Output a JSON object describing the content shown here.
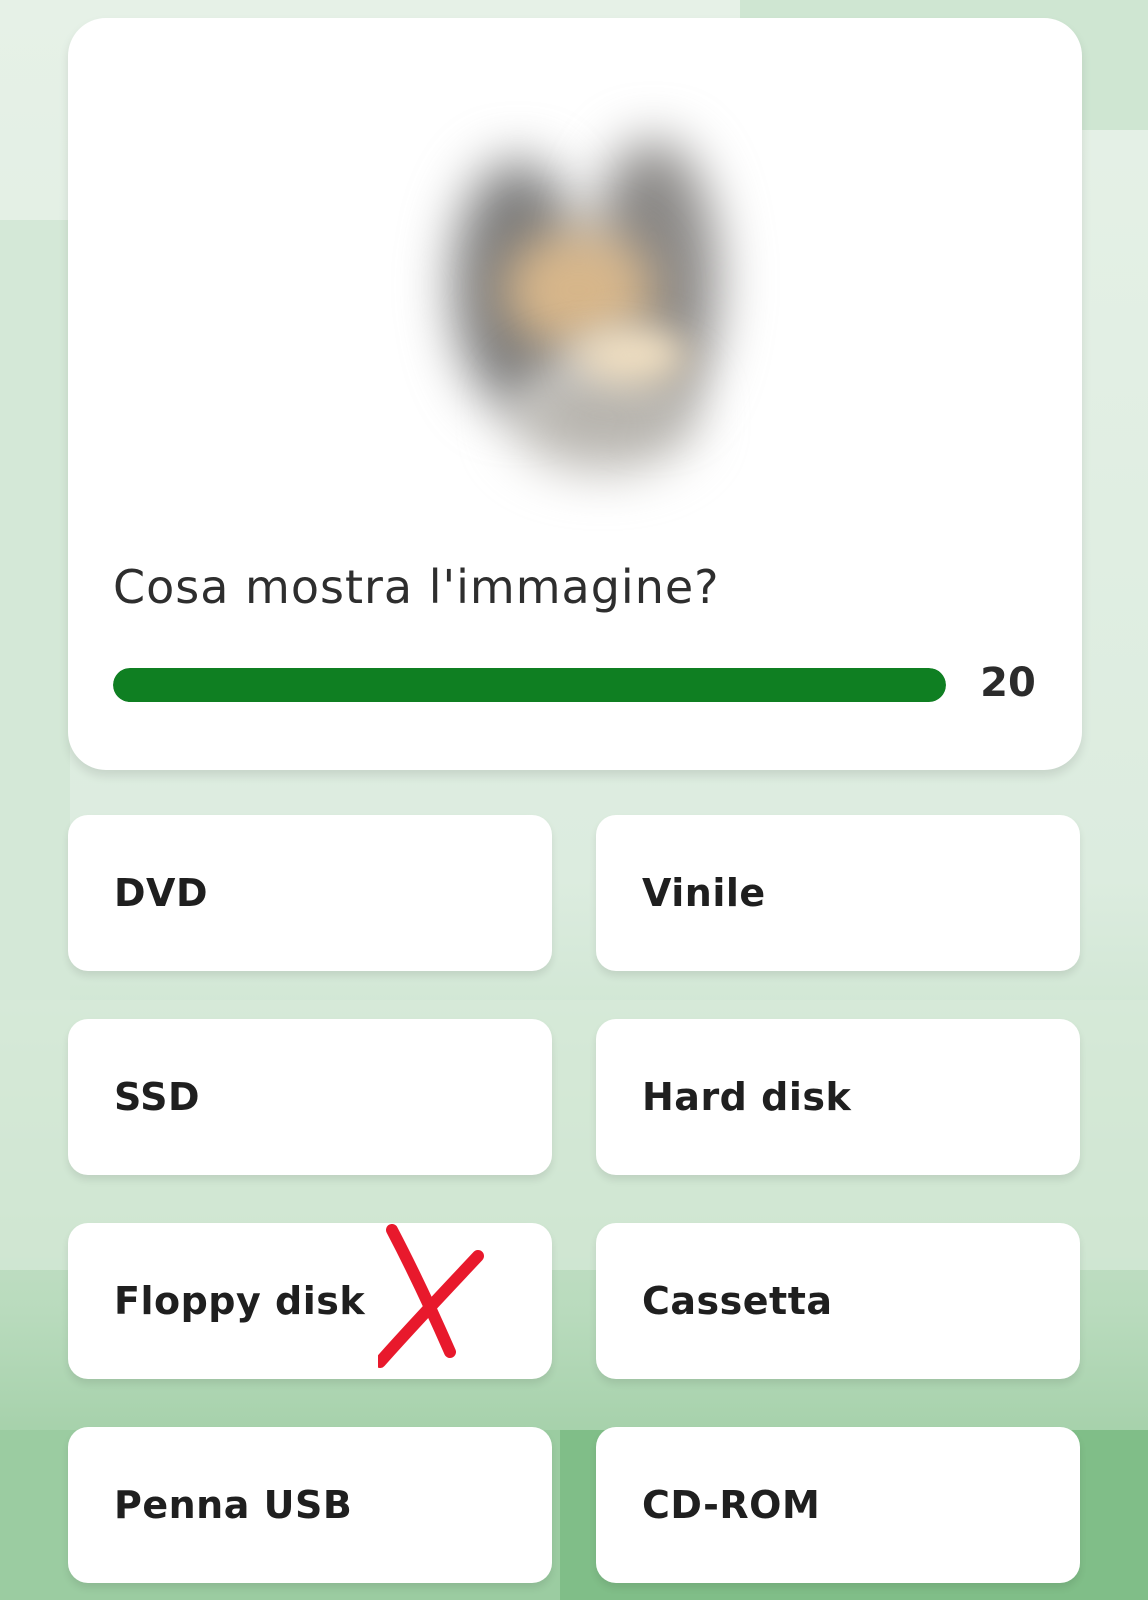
{
  "question": {
    "text": "Cosa mostra l'immagine?",
    "timer_value": "20",
    "timer_fraction": 1.0,
    "timer_color": "#0f7f22"
  },
  "answers": [
    {
      "label": "DVD"
    },
    {
      "label": "Vinile"
    },
    {
      "label": "SSD"
    },
    {
      "label": "Hard disk"
    },
    {
      "label": "Floppy disk",
      "marked_wrong": true
    },
    {
      "label": "Cassetta"
    },
    {
      "label": "Penna USB"
    },
    {
      "label": "CD-ROM"
    }
  ],
  "annotation": {
    "icon": "cross-mark-icon",
    "color": "#e8192c"
  }
}
